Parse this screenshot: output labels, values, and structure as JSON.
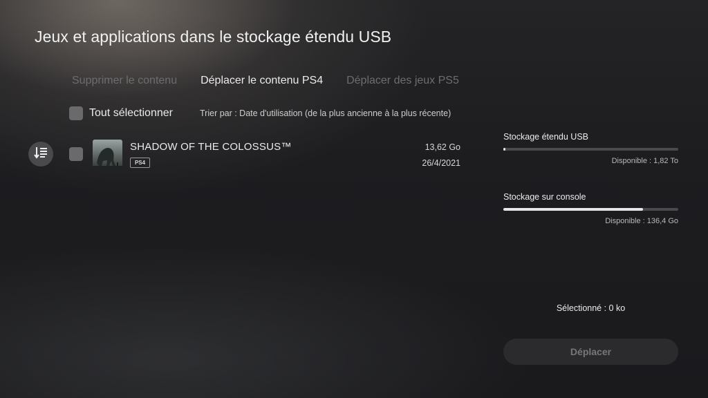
{
  "title": "Jeux et applications dans le stockage étendu USB",
  "tabs": [
    {
      "label": "Supprimer le contenu",
      "state": "disabled"
    },
    {
      "label": "Déplacer le contenu PS4",
      "state": "active"
    },
    {
      "label": "Déplacer des jeux PS5",
      "state": "disabled"
    }
  ],
  "select_all": {
    "label": "Tout sélectionner",
    "checked": false
  },
  "sort": {
    "label": "Trier par : Date d'utilisation (de la plus ancienne à la plus récente)",
    "icon": "sort-icon"
  },
  "games": [
    {
      "title": "SHADOW OF THE COLOSSUS™",
      "badge": "PS4",
      "size": "13,62 Go",
      "date": "26/4/2021",
      "checked": false
    }
  ],
  "storage": [
    {
      "label": "Stockage étendu USB",
      "available": "Disponible : 1,82 To",
      "used_fraction": 0.01
    },
    {
      "label": "Stockage sur console",
      "available": "Disponible : 136,4 Go",
      "used_fraction": 0.8
    }
  ],
  "selected": "Sélectionné : 0 ko",
  "move_button": {
    "label": "Déplacer",
    "enabled": false
  }
}
